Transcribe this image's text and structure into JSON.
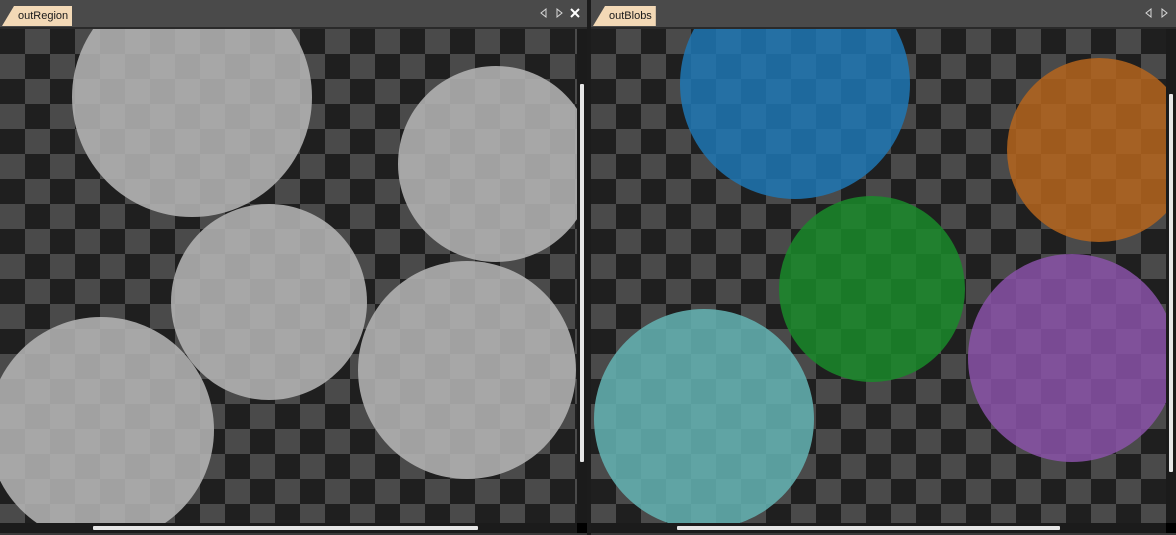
{
  "left_panel": {
    "tab_label": "outRegion",
    "icons": [
      "prev-arrow-icon",
      "next-arrow-icon",
      "close-icon"
    ],
    "region_color": "#aaaaaa"
  },
  "right_panel": {
    "tab_label": "outBlobs",
    "icons": [
      "prev-arrow-icon",
      "next-arrow-icon"
    ],
    "blob_colors": {
      "blue": "#1f77b4",
      "orange": "#b5651d",
      "green": "#1a8a2a",
      "purple": "#8a52a8",
      "teal": "#63b0b0"
    }
  },
  "background_colors": {
    "dark": "#1f1f1f",
    "light": "#4a4a4a"
  }
}
